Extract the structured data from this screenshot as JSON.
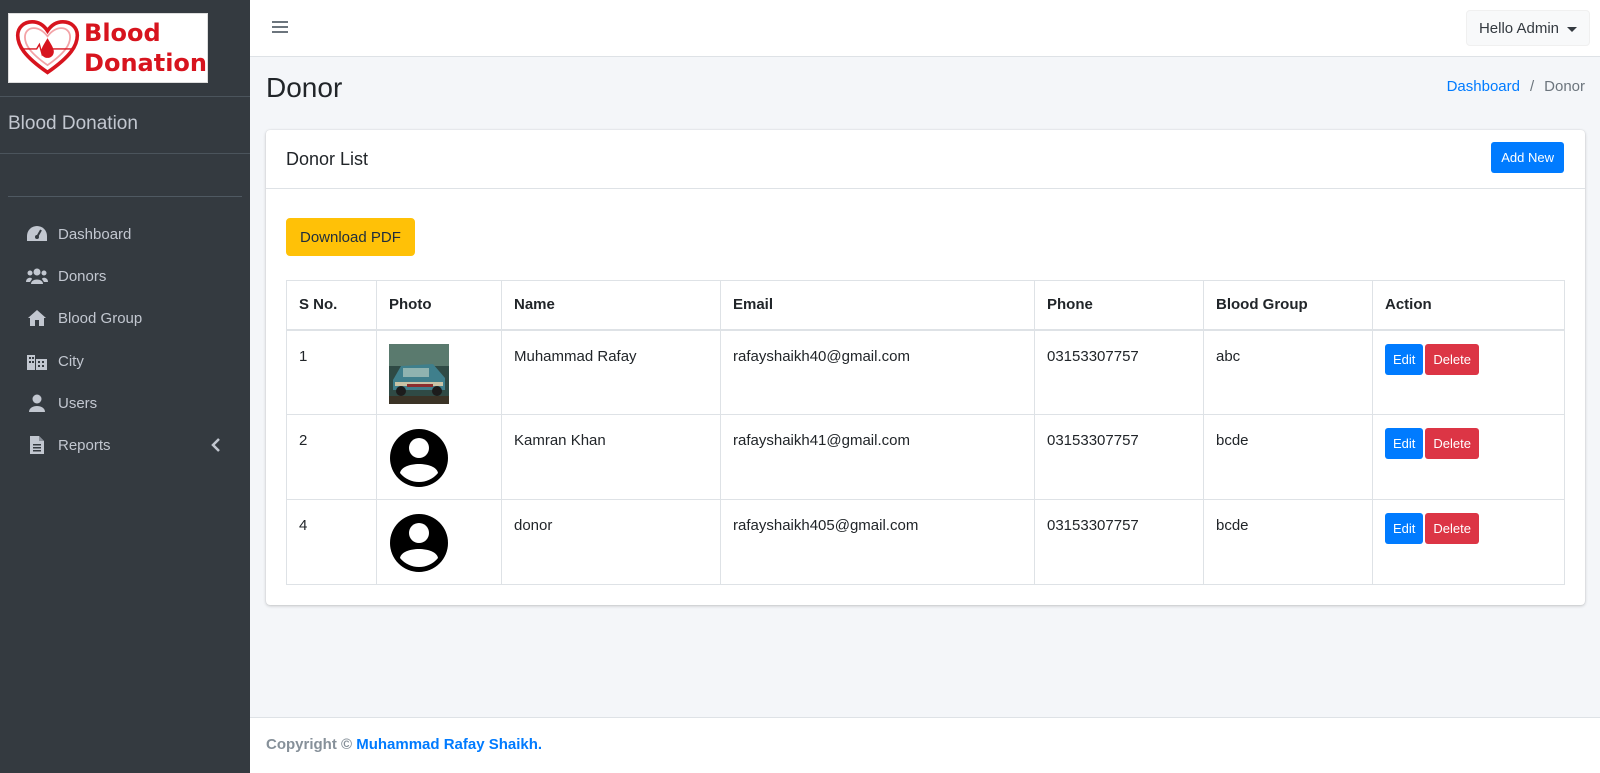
{
  "logo": {
    "line1": "Blood",
    "line2": "Donation"
  },
  "brand": "Blood Donation",
  "sidebar": {
    "items": [
      {
        "label": "Dashboard",
        "icon": "tachometer-icon"
      },
      {
        "label": "Donors",
        "icon": "users-icon"
      },
      {
        "label": "Blood Group",
        "icon": "home-icon"
      },
      {
        "label": "City",
        "icon": "city-icon"
      },
      {
        "label": "Users",
        "icon": "user-icon"
      },
      {
        "label": "Reports",
        "icon": "file-icon"
      }
    ]
  },
  "topbar": {
    "user_menu": "Hello Admin"
  },
  "page": {
    "title": "Donor",
    "breadcrumb": {
      "home": "Dashboard",
      "current": "Donor"
    }
  },
  "card": {
    "title": "Donor List",
    "add_button": "Add New",
    "pdf_button": "Download PDF"
  },
  "table": {
    "headers": [
      "S No.",
      "Photo",
      "Name",
      "Email",
      "Phone",
      "Blood Group",
      "Action"
    ],
    "rows": [
      {
        "sno": "1",
        "photo": "car-photo",
        "name": "Muhammad Rafay",
        "email": "rafayshaikh40@gmail.com",
        "phone": "03153307757",
        "blood_group": "abc"
      },
      {
        "sno": "2",
        "photo": "default-avatar",
        "name": "Kamran Khan",
        "email": "rafayshaikh41@gmail.com",
        "phone": "03153307757",
        "blood_group": "bcde"
      },
      {
        "sno": "4",
        "photo": "default-avatar",
        "name": "donor",
        "email": "rafayshaikh405@gmail.com",
        "phone": "03153307757",
        "blood_group": "bcde"
      }
    ],
    "edit_label": "Edit",
    "delete_label": "Delete"
  },
  "footer": {
    "prefix": "Copyright © ",
    "author": "Muhammad Rafay Shaikh."
  },
  "colors": {
    "sidebar": "#343a40",
    "primary": "#007bff",
    "danger": "#dc3545",
    "warning": "#ffc107",
    "logo_red": "#d7141e"
  }
}
